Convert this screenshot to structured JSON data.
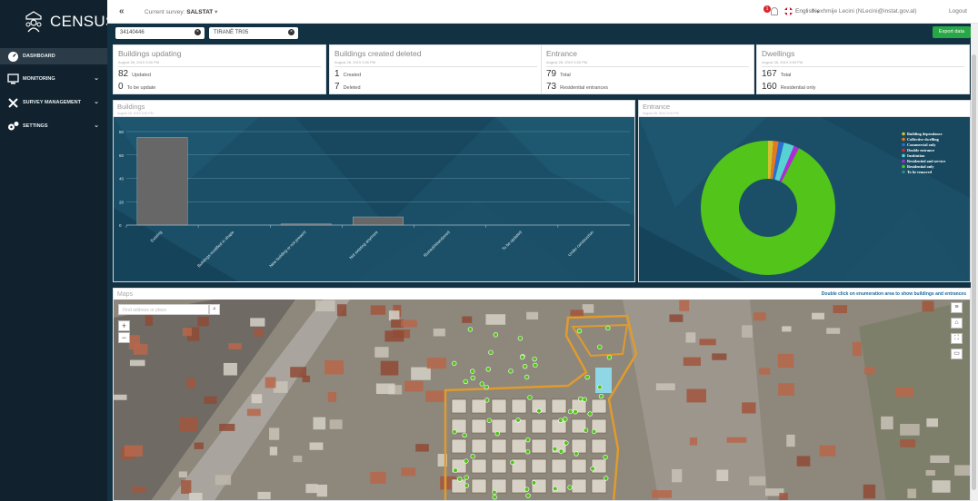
{
  "app": {
    "title": "CENSUS"
  },
  "sidebar": {
    "items": [
      {
        "label": "Dashboard",
        "icon": "dashboard-icon"
      },
      {
        "label": "Monitoring",
        "icon": "monitor-icon"
      },
      {
        "label": "Survey management",
        "icon": "tools-icon"
      },
      {
        "label": "Settings",
        "icon": "gears-icon"
      }
    ]
  },
  "topbar": {
    "collapse": "«",
    "survey_label": "Current survey:",
    "survey_value": "SALSTAT",
    "notification_count": "1",
    "language": "English",
    "user": "Nexhmije Lecini (NLecini@instat.gov.al)",
    "logout": "Logout"
  },
  "filters": {
    "area_code": "34140446",
    "area_name": "TIRANË TR05",
    "export_label": "Export data"
  },
  "stats": [
    {
      "title": "Buildings updating",
      "date": "August 28, 2019 3:00 PM",
      "rows": [
        {
          "n": "82",
          "label": "Updated"
        },
        {
          "n": "0",
          "label": "To be update"
        }
      ]
    },
    {
      "title": "Buildings created deleted",
      "date": "August 28, 2019 3:00 PM",
      "rows": [
        {
          "n": "1",
          "label": "Created"
        },
        {
          "n": "7",
          "label": "Deleted"
        }
      ]
    },
    {
      "title": "Entrance",
      "date": "August 28, 2019 3:00 PM",
      "rows": [
        {
          "n": "79",
          "label": "Total"
        },
        {
          "n": "73",
          "label": "Residential entrances"
        }
      ]
    },
    {
      "title": "Dwellings",
      "date": "August 28, 2019 3:00 PM",
      "rows": [
        {
          "n": "167",
          "label": "Total"
        },
        {
          "n": "160",
          "label": "Residential only"
        }
      ]
    }
  ],
  "panels": {
    "buildings": {
      "title": "Buildings",
      "date": "August 28, 2019 3:00 PM"
    },
    "entrance": {
      "title": "Entrance",
      "date": "August 28, 2019 3:00 PM"
    }
  },
  "map": {
    "title": "Maps",
    "hint": "Double click on enumeration area to show buildings and entrances",
    "search_placeholder": "Find address or place",
    "zoom_in": "+",
    "zoom_out": "−"
  },
  "chart_data": [
    {
      "type": "bar",
      "categories": [
        "Existing",
        "Buildings modified in shape",
        "New building or not present",
        "Not existing anymore",
        "Ruined/Abandoned",
        "To be updated",
        "Under construction"
      ],
      "values": [
        75,
        0,
        1,
        7,
        0,
        0,
        0
      ],
      "ylim": [
        0,
        80
      ],
      "yticks": [
        0,
        20,
        40,
        60,
        80
      ],
      "grid": true,
      "bar_color": "#676767"
    },
    {
      "type": "pie",
      "donut": true,
      "legend_position": "right",
      "labels": [
        "Building dependance",
        "Collective dwelling",
        "Commercial only",
        "Double entrance",
        "Institution",
        "Residential and service",
        "Residential only",
        "To be removed"
      ],
      "values": [
        1,
        1,
        1,
        0,
        2,
        1,
        73,
        0
      ],
      "colors": [
        "#d4c02e",
        "#e07b21",
        "#2a6fd1",
        "#d9272e",
        "#57d2d2",
        "#b02bd4",
        "#52c41a",
        "#2f8a8a"
      ]
    }
  ]
}
